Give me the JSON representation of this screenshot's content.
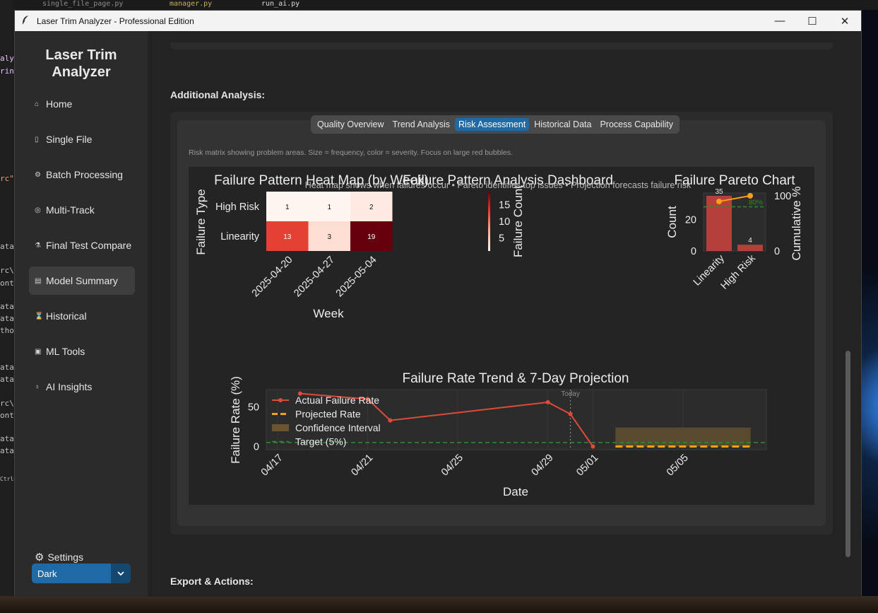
{
  "window": {
    "title": "Laser Trim Analyzer - Professional Edition",
    "minimize": "—",
    "maximize": "☐",
    "close": "✕"
  },
  "background": {
    "editor_tabs": [
      "single_file_page.py",
      "manager.py",
      "run_ai.py"
    ],
    "code_fragments": [
      "aly",
      "ring",
      "rc\"",
      "ata",
      "rc\\",
      "ont",
      "ata",
      "ata",
      "tho",
      "ata",
      "ata",
      "rc\\",
      "ont",
      "ata",
      "ata",
      "Ctrl+"
    ]
  },
  "sidebar": {
    "logo_line1": "Laser Trim",
    "logo_line2": "Analyzer",
    "items": [
      {
        "label": "Home",
        "icon": "home-icon"
      },
      {
        "label": "Single File",
        "icon": "file-icon"
      },
      {
        "label": "Batch Processing",
        "icon": "batch-icon"
      },
      {
        "label": "Multi-Track",
        "icon": "multi-track-icon"
      },
      {
        "label": "Final Test Compare",
        "icon": "compare-icon"
      },
      {
        "label": "Model Summary",
        "icon": "summary-icon",
        "active": true
      },
      {
        "label": "Historical",
        "icon": "historical-icon"
      },
      {
        "label": "ML Tools",
        "icon": "ml-icon"
      },
      {
        "label": "AI Insights",
        "icon": "lightbulb-icon"
      }
    ],
    "settings_label": "Settings",
    "theme_value": "Dark"
  },
  "main": {
    "additional_title": "Additional Analysis:",
    "export_title": "Export & Actions:",
    "tabs": [
      "Quality Overview",
      "Trend Analysis",
      "Risk Assessment",
      "Historical Data",
      "Process Capability"
    ],
    "active_tab": "Risk Assessment",
    "help_text": "Risk matrix showing problem areas. Size = frequency, color = severity. Focus on large red bubbles."
  },
  "figure": {
    "suptitle": "Failure Pattern Analysis Dashboard",
    "subtitle": "Heat map shows when failures occur • Pareto identifies top issues • Projection forecasts failure risk"
  },
  "chart_data": [
    {
      "type": "heatmap",
      "title": "Failure Pattern Heat Map (by Week)",
      "xlabel": "Week",
      "ylabel": "Failure Type",
      "x": [
        "2025-04-20",
        "2025-04-27",
        "2025-05-04"
      ],
      "y": [
        "High Risk",
        "Linearity"
      ],
      "values": [
        [
          1,
          1,
          2
        ],
        [
          13,
          3,
          19
        ]
      ],
      "colorbar_label": "Failure Count",
      "colorbar_ticks": [
        "15",
        "10",
        "5"
      ]
    },
    {
      "type": "bar",
      "title": "Failure Pareto Chart",
      "categories": [
        "Linearity",
        "High Risk"
      ],
      "values": [
        35,
        4
      ],
      "ylabel": "Count",
      "y2label": "Cumulative %",
      "y_ticks": [
        "0",
        "20"
      ],
      "y2_ticks": [
        "0",
        "100"
      ],
      "cumulative_pct": [
        89.7,
        100
      ],
      "threshold_label": "80%",
      "threshold": 80
    },
    {
      "type": "line",
      "title": "Failure Rate Trend & 7-Day Projection",
      "xlabel": "Date",
      "ylabel": "Failure Rate (%)",
      "x_ticks": [
        "04/17",
        "04/21",
        "04/25",
        "04/29",
        "05/01",
        "05/05"
      ],
      "y_ticks": [
        "0",
        "50"
      ],
      "today_label": "Today",
      "today_x": "04/30",
      "series": [
        {
          "name": "Actual Failure Rate",
          "x": [
            "04/18",
            "04/21",
            "04/22",
            "04/29",
            "04/30",
            "05/01"
          ],
          "values": [
            67,
            60,
            33,
            56,
            41,
            0
          ]
        },
        {
          "name": "Projected Rate",
          "x": [
            "05/02",
            "05/08"
          ],
          "values": [
            0,
            0
          ]
        },
        {
          "name": "Confidence Interval",
          "x": [
            "05/02",
            "05/08"
          ],
          "lower": [
            0,
            0
          ],
          "upper": [
            24,
            24
          ]
        },
        {
          "name": "Target (5%)",
          "value": 5
        }
      ]
    }
  ]
}
